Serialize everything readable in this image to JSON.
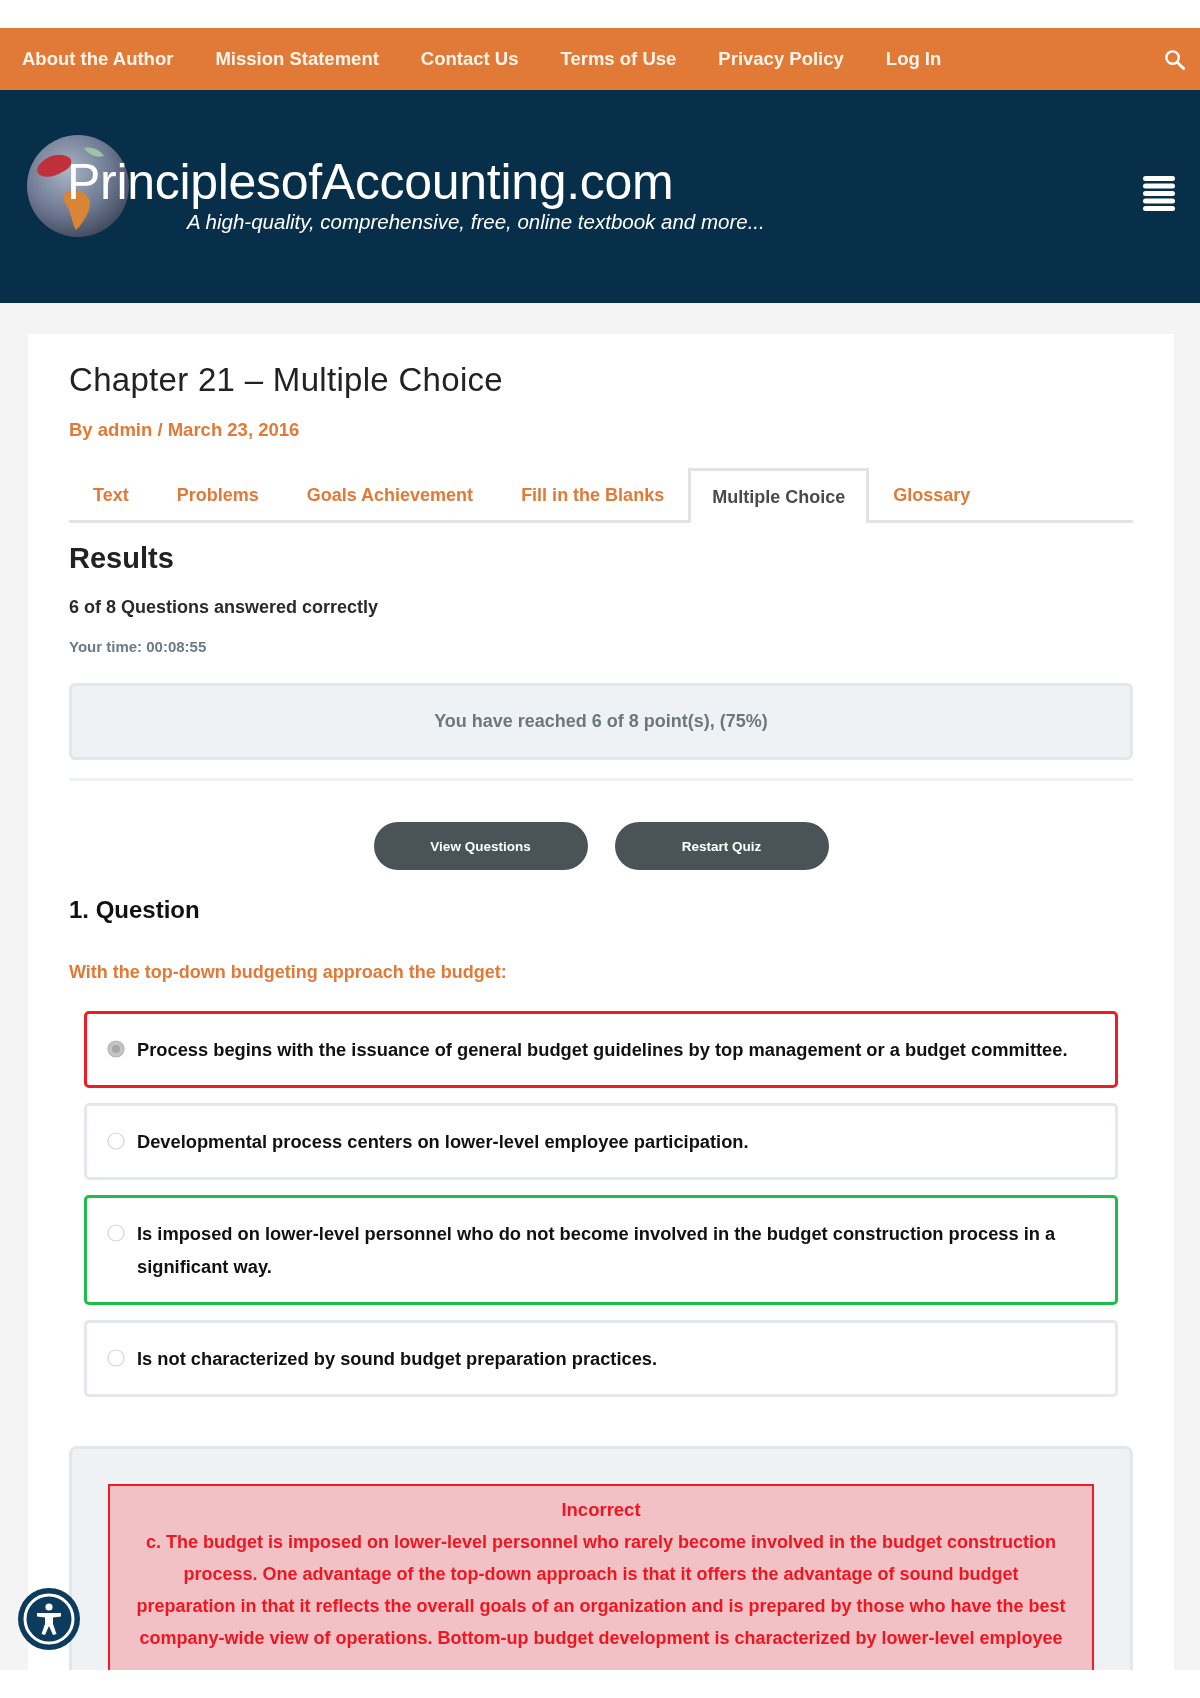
{
  "top_nav": {
    "links": [
      "About the Author",
      "Mission Statement",
      "Contact Us",
      "Terms of Use",
      "Privacy Policy",
      "Log In"
    ]
  },
  "header": {
    "site_name": "PrinciplesofAccounting.com",
    "tagline": "A high-quality, comprehensive, free, online textbook and more..."
  },
  "post": {
    "title": "Chapter 21 – Multiple Choice",
    "meta": "By admin / March 23, 2016"
  },
  "tabs": [
    {
      "label": "Text",
      "selected": false
    },
    {
      "label": "Problems",
      "selected": false
    },
    {
      "label": "Goals Achievement",
      "selected": false
    },
    {
      "label": "Fill in the Blanks",
      "selected": false
    },
    {
      "label": "Multiple Choice",
      "selected": true
    },
    {
      "label": "Glossary",
      "selected": false
    }
  ],
  "results": {
    "heading": "Results",
    "summary": "6 of 8 Questions answered correctly",
    "time": "Your time: 00:08:55",
    "score": "You have reached 6 of 8 point(s), (75%)",
    "buttons": [
      "View Questions",
      "Restart Quiz"
    ]
  },
  "question": {
    "heading": "1. Question",
    "prompt": "With the top-down budgeting approach the budget:",
    "answers": [
      {
        "text": "Process begins with the issuance of general budget guidelines by top management or a budget committee.",
        "selected": true,
        "marked_correct": false,
        "marked_wrong": true
      },
      {
        "text": "Developmental process centers on lower-level employee participation.",
        "selected": false,
        "marked_correct": false,
        "marked_wrong": false
      },
      {
        "text": "Is imposed on lower-level personnel who do not become involved in the budget construction process in a significant way.",
        "selected": false,
        "marked_correct": true,
        "marked_wrong": false
      },
      {
        "text": "Is not characterized by sound budget preparation practices.",
        "selected": false,
        "marked_correct": false,
        "marked_wrong": false
      }
    ]
  },
  "feedback": {
    "correct": false,
    "title": "Incorrect",
    "explanation": "c. The budget is imposed on lower-level personnel who rarely become involved in the budget construction process. One advantage of the top-down approach is that it offers the advantage of sound budget preparation in that it reflects the overall goals of an organization and is prepared by those who have the best company-wide view of operations. Bottom-up budget development is characterized by lower-level employee"
  }
}
